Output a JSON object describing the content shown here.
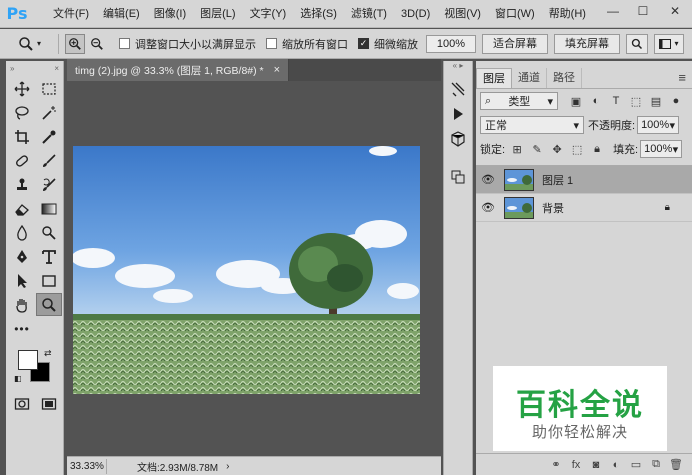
{
  "app": {
    "logo": "Ps"
  },
  "menu": [
    "文件(F)",
    "编辑(E)",
    "图像(I)",
    "图层(L)",
    "文字(Y)",
    "选择(S)",
    "滤镜(T)",
    "3D(D)",
    "视图(V)",
    "窗口(W)",
    "帮助(H)"
  ],
  "window_controls": {
    "minimize": "—",
    "maximize": "☐",
    "close": "✕"
  },
  "options": {
    "resize_windows_label": "调整窗口大小以满屏显示",
    "resize_windows_checked": false,
    "zoom_all_label": "缩放所有窗口",
    "zoom_all_checked": false,
    "scrubby_zoom_label": "细微缩放",
    "scrubby_zoom_checked": true,
    "zoom_value": "100%",
    "fit_screen_label": "适合屏幕",
    "fill_screen_label": "填充屏幕"
  },
  "document": {
    "tab_title": "timg (2).jpg @ 33.3% (图层 1, RGB/8#) *",
    "tab_close": "×",
    "status_zoom": "33.33%",
    "status_doc": "文档:2.93M/8.78M"
  },
  "layers_panel": {
    "tabs": [
      "图层",
      "通道",
      "路径"
    ],
    "filter_kind": "类型",
    "blend_mode": "正常",
    "opacity_label": "不透明度:",
    "opacity_value": "100%",
    "lock_label": "锁定:",
    "fill_label": "填充:",
    "fill_value": "100%",
    "layers": [
      {
        "name": "图层 1",
        "selected": true,
        "locked": false
      },
      {
        "name": "背景",
        "selected": false,
        "locked": true
      }
    ],
    "footer_icons": [
      "link-icon",
      "fx-icon",
      "mask-icon",
      "adjustment-icon",
      "group-icon",
      "new-layer-icon",
      "trash-icon"
    ]
  },
  "watermark": {
    "main": "百科全说",
    "sub": "助你轻松解决"
  },
  "colors": {
    "accent": "#2fa3f6",
    "watermark_green": "#25a244",
    "panel_bg": "#d6d6d6",
    "workspace": "#535353"
  }
}
